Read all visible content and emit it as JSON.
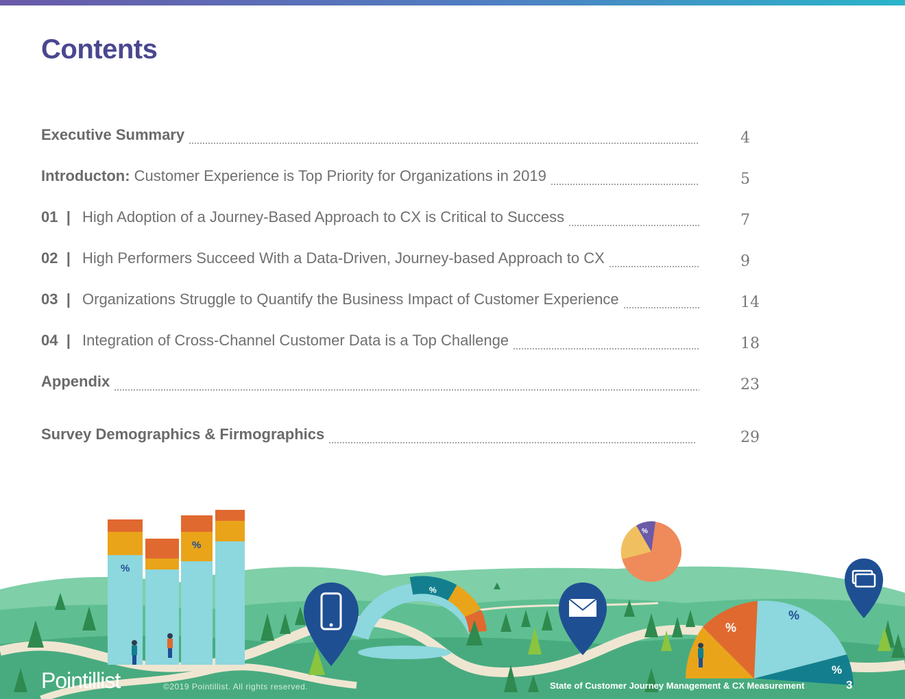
{
  "page_title": "Contents",
  "toc": [
    {
      "lead": "Executive Summary",
      "text": "",
      "number": "",
      "page": "4"
    },
    {
      "lead": "Introducton:",
      "text": " Customer Experience is Top Priority for Organizations in 2019",
      "number": "",
      "page": "5"
    },
    {
      "lead": "",
      "number": "01  |",
      "text": "High Adoption of a Journey-Based Approach to CX is Critical to Success",
      "page": "7"
    },
    {
      "lead": "",
      "number": "02  |",
      "text": "High Performers Succeed With a Data-Driven, Journey-based Approach to CX",
      "page": "9"
    },
    {
      "lead": "",
      "number": "03  |",
      "text": "Organizations Struggle to Quantify the Business Impact of Customer Experience",
      "page": "14"
    },
    {
      "lead": "",
      "number": "04  |",
      "text": "Integration of Cross-Channel Customer Data is a Top Challenge",
      "page": "18"
    },
    {
      "lead": "Appendix",
      "text": "",
      "number": "",
      "page": "23"
    },
    {
      "lead": "Survey Demographics & Firmographics",
      "text": "",
      "number": "",
      "page": "29"
    }
  ],
  "footer": {
    "logo": "Pointillist",
    "copyright": "©2019 Pointillist. All rights reserved.",
    "report_title": "State of Customer Journey Management & CX Measurement",
    "page_number": "3"
  },
  "illustration": {
    "percent_symbol": "%",
    "colors": {
      "green": "#4fb58f",
      "path": "#efe6d2",
      "teal": "#8dd7de",
      "orange": "#e0692f",
      "yellow": "#e9a41a",
      "navy": "#1f4f93",
      "purple": "#6a5aa8"
    }
  }
}
